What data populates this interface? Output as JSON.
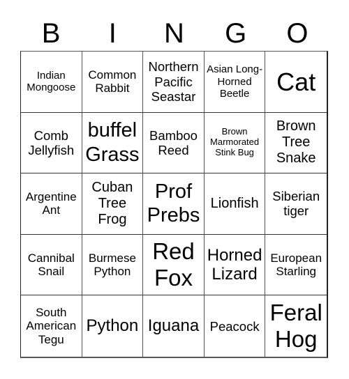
{
  "header": {
    "letters": [
      "B",
      "I",
      "N",
      "G",
      "O"
    ]
  },
  "cells": [
    "Indian Mongoose",
    "Common Rabbit",
    "Northern Pacific Seastar",
    "Asian Long-Horned Beetle",
    "Cat",
    "Comb Jellyfish",
    "buffel Grass",
    "Bamboo Reed",
    "Brown Marmorated Stink Bug",
    "Brown Tree Snake",
    "Argentine Ant",
    "Cuban Tree Frog",
    "Prof Prebs",
    "Lionfish",
    "Siberian tiger",
    "Cannibal Snail",
    "Burmese Python",
    "Red Fox",
    "Horned Lizard",
    "European Starling",
    "South American Tegu",
    "Python",
    "Iguana",
    "Peacock",
    "Feral Hog"
  ]
}
